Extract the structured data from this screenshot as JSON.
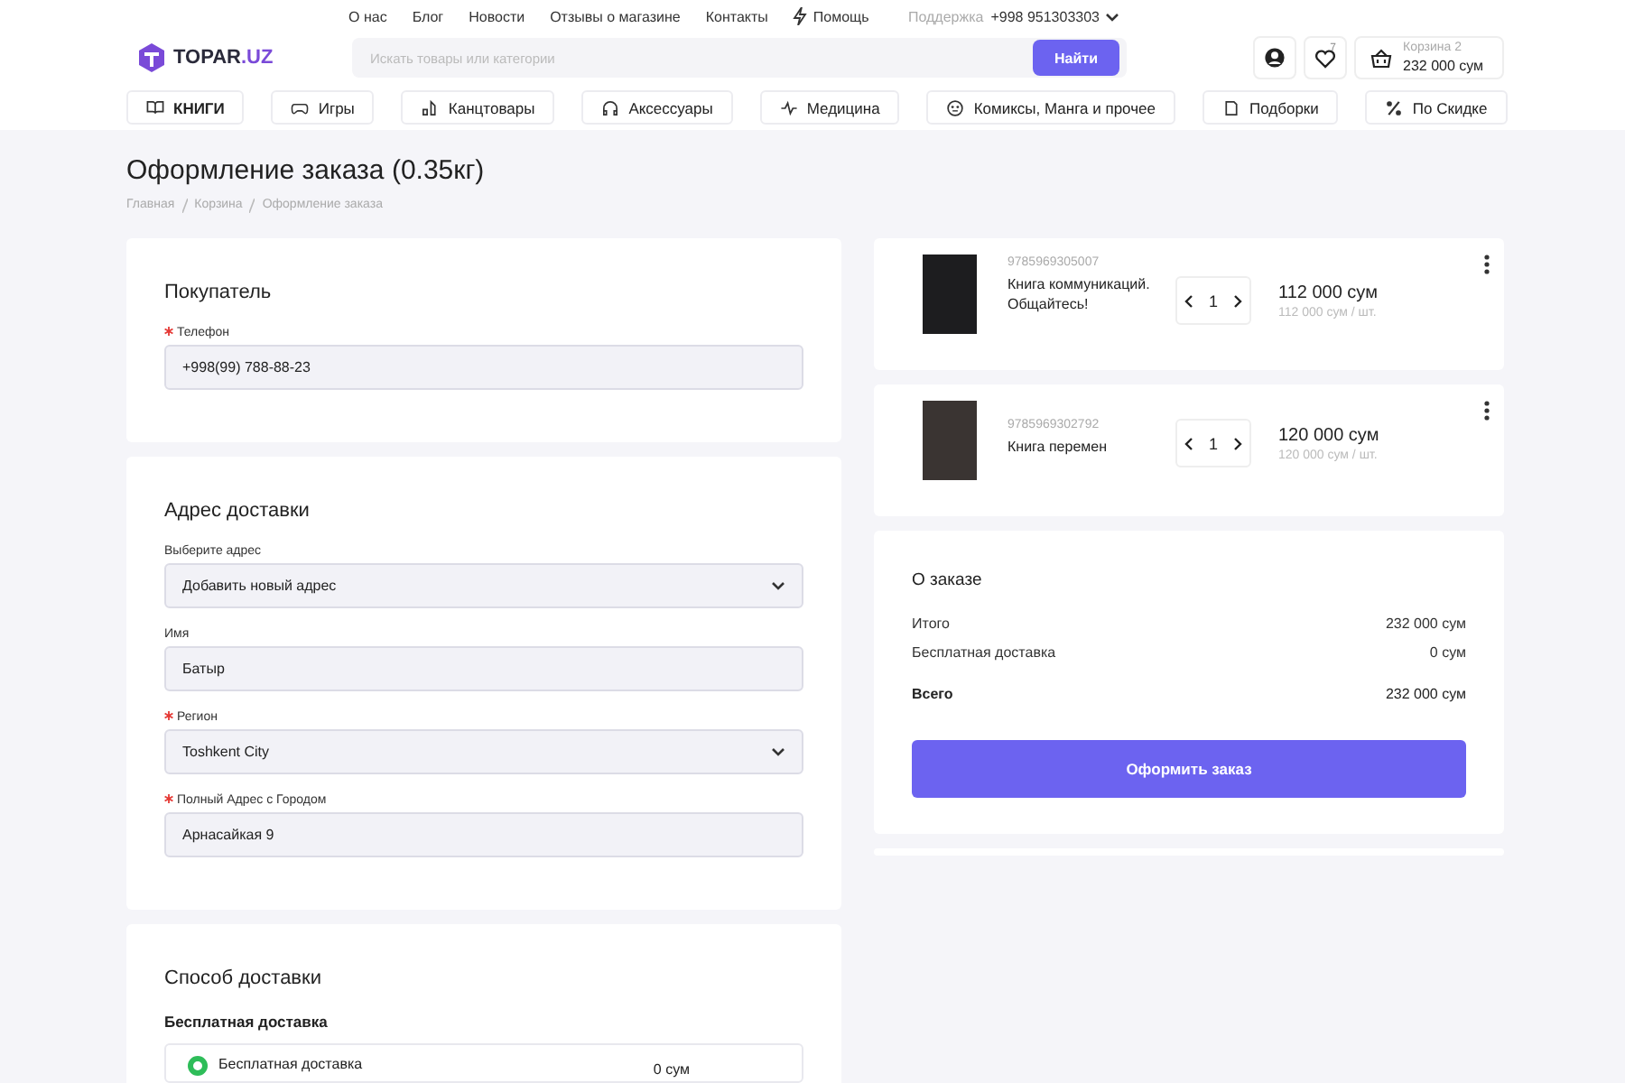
{
  "top_links": [
    {
      "label": "О нас",
      "kind": "link"
    },
    {
      "label": "Блог",
      "kind": "link"
    },
    {
      "label": "Новости",
      "kind": "link"
    },
    {
      "label": "Отзывы о магазине",
      "kind": "link"
    },
    {
      "label": "Контакты",
      "kind": "link"
    },
    {
      "label": "Помощь",
      "kind": "help"
    }
  ],
  "support": {
    "label": "Поддержка",
    "phone": "+998 951303303"
  },
  "logo": {
    "name": "TOPAR",
    "suffix": ".UZ"
  },
  "search": {
    "placeholder": "Искать товары или категории",
    "button": "Найти"
  },
  "wishlist": {
    "count": "7"
  },
  "cart": {
    "label": "Корзина 2",
    "total": "232 000 сум"
  },
  "categories": [
    {
      "label": "КНИГИ",
      "kind": "book"
    },
    {
      "label": "Игры",
      "kind": "game"
    },
    {
      "label": "Канцтовары",
      "kind": "stationery"
    },
    {
      "label": "Аксессуары",
      "kind": "accessory"
    },
    {
      "label": "Медицина",
      "kind": "medicine"
    },
    {
      "label": "Комиксы, Манга и прочее",
      "kind": "comics"
    },
    {
      "label": "Подборки",
      "kind": "collection"
    },
    {
      "label": "По Скидке",
      "kind": "discount"
    }
  ],
  "page": {
    "title": "Оформление заказа (0.35кг)",
    "breadcrumbs": [
      "Главная",
      "Корзина",
      "Оформление заказа"
    ]
  },
  "buyer": {
    "title": "Покупатель",
    "fields": [
      {
        "label": "Телефон",
        "required": true,
        "kind": "input",
        "value": "+998(99) 788-88-23"
      }
    ]
  },
  "address": {
    "title": "Адрес доставки",
    "fields": [
      {
        "label": "Выберите адрес",
        "required": false,
        "kind": "select",
        "value": "Добавить новый адрес"
      },
      {
        "label": "Имя",
        "required": false,
        "kind": "input",
        "value": "Батыр"
      },
      {
        "label": "Регион",
        "required": true,
        "kind": "select",
        "value": "Toshkent City"
      },
      {
        "label": "Полный Адрес с Городом",
        "required": true,
        "kind": "input",
        "value": "Арнасайкая 9"
      }
    ]
  },
  "delivery": {
    "title": "Способ доставки",
    "group": "Бесплатная доставка",
    "options": [
      {
        "label": "Бесплатная доставка",
        "price": "0 сум",
        "selected": true
      }
    ]
  },
  "cart_items": [
    {
      "sku": "9785969305007",
      "name": "Книга коммуникаций. Общайтесь!",
      "quantity": "1",
      "price": "112 000 сум",
      "unit_price": "112 000 сум / шт."
    },
    {
      "sku": "9785969302792",
      "name": "Книга перемен",
      "quantity": "1",
      "price": "120 000 сум",
      "unit_price": "120 000 сум / шт."
    }
  ],
  "summary": {
    "title": "О заказе",
    "lines": [
      {
        "label": "Итого",
        "value": "232 000 сум",
        "kind": "line"
      },
      {
        "label": "Бесплатная доставка",
        "value": "0 сум",
        "kind": "line"
      },
      {
        "label": "Всего",
        "value": "232 000 сум",
        "kind": "total"
      }
    ],
    "button": "Оформить заказ"
  }
}
